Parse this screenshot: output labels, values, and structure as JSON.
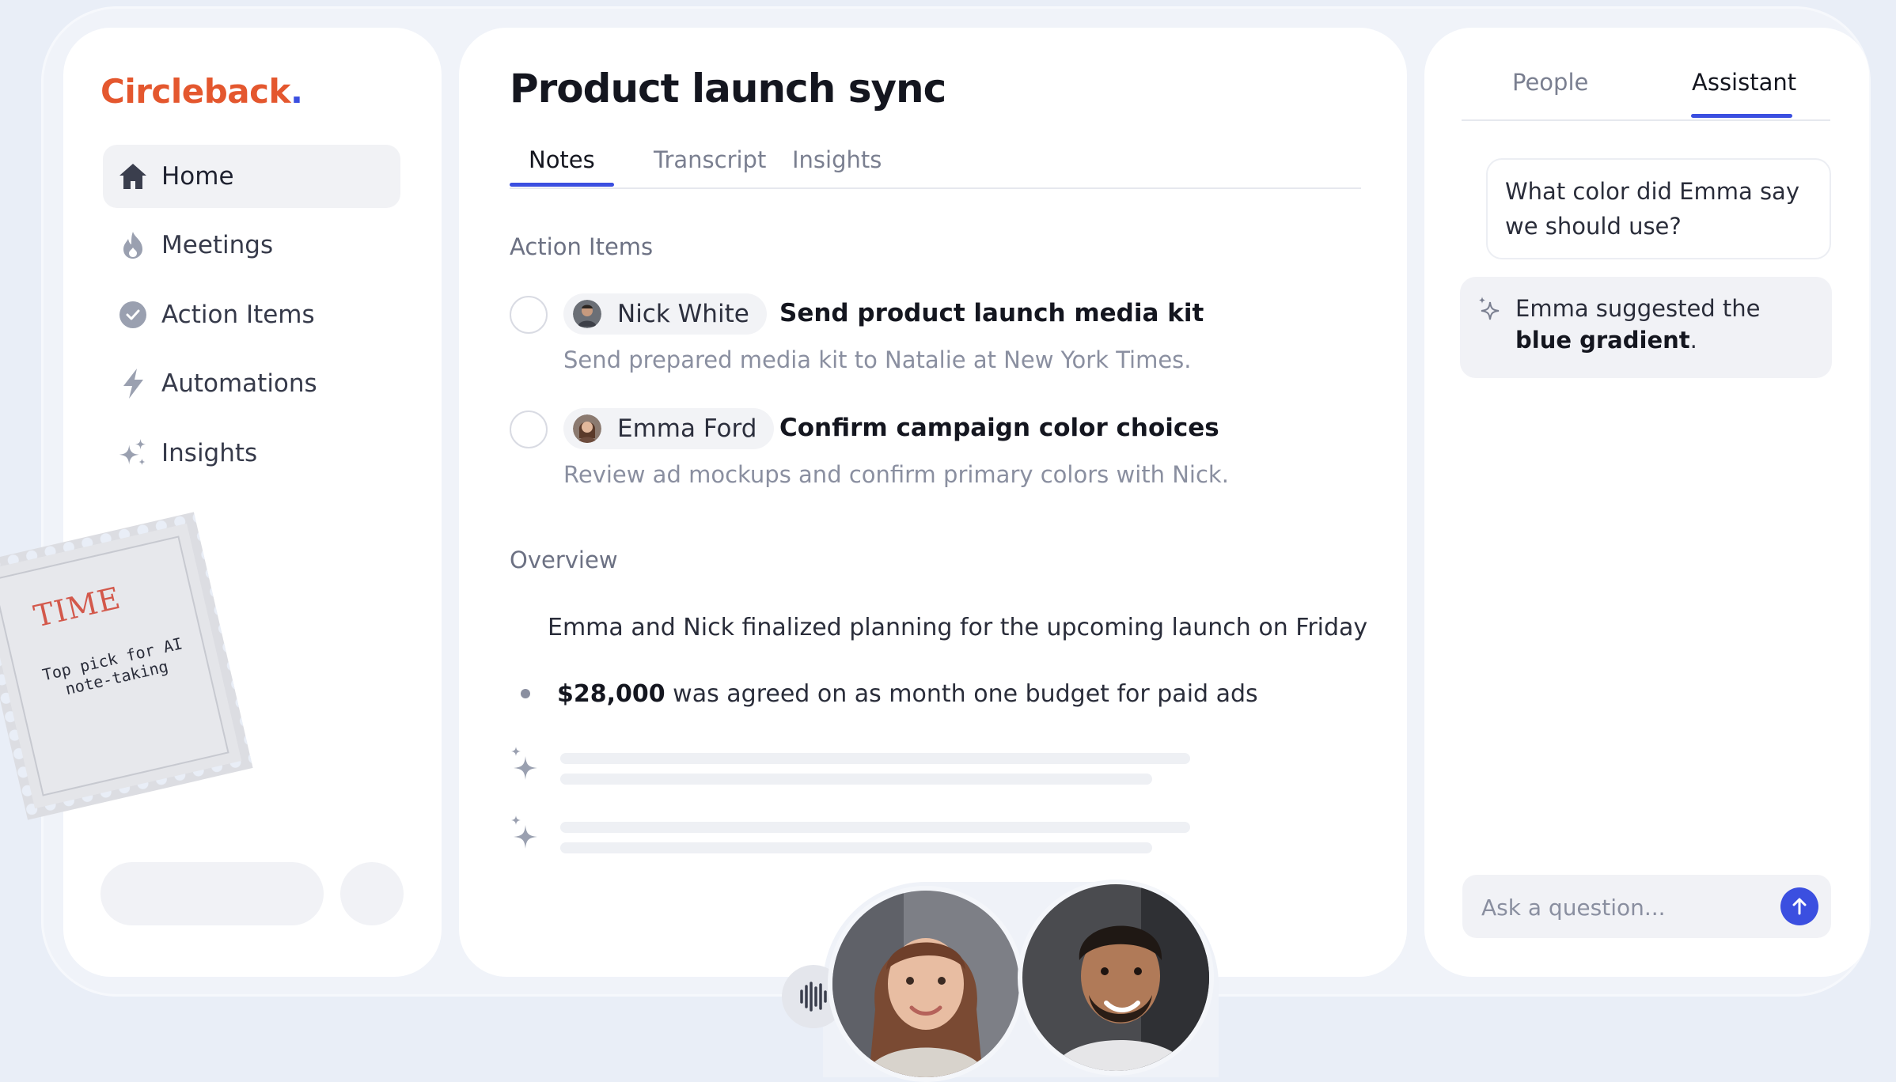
{
  "brand": {
    "name": "Circleback",
    "dot": "."
  },
  "sidebar": {
    "items": [
      {
        "label": "Home",
        "icon": "home-icon",
        "active": true
      },
      {
        "label": "Meetings",
        "icon": "flame-icon"
      },
      {
        "label": "Action Items",
        "icon": "check-circle-icon"
      },
      {
        "label": "Automations",
        "icon": "lightning-icon"
      },
      {
        "label": "Insights",
        "icon": "sparkles-icon"
      }
    ]
  },
  "main": {
    "title": "Product launch sync",
    "tabs": [
      {
        "label": "Notes",
        "active": true
      },
      {
        "label": "Transcript"
      },
      {
        "label": "Insights"
      }
    ],
    "action_items_title": "Action Items",
    "action_items": [
      {
        "assignee": "Nick White",
        "title": "Send product launch media kit",
        "description": "Send prepared media kit to Natalie at New York Times.",
        "done": false
      },
      {
        "assignee": "Emma Ford",
        "title": "Confirm campaign color choices",
        "description": "Review ad mockups and confirm primary colors with Nick.",
        "done": false
      }
    ],
    "overview_title": "Overview",
    "overview": [
      {
        "bold": "",
        "text": "Emma and Nick finalized  planning for the upcoming launch on Friday"
      },
      {
        "bold": "$28,000",
        "text": " was agreed on as month one budget for paid ads"
      }
    ]
  },
  "assistant": {
    "tabs": [
      {
        "label": "People"
      },
      {
        "label": "Assistant",
        "active": true
      }
    ],
    "user_message": "What color did Emma say we should use?",
    "reply_prefix": "Emma suggested the ",
    "reply_bold": "blue gradient",
    "reply_suffix": ".",
    "input_placeholder": "Ask a question..."
  },
  "stamp": {
    "brand": "TIME",
    "line1": "Top pick for AI",
    "line2": "note-taking"
  },
  "colors": {
    "brand": "#e4572e",
    "accent": "#3b4fe0",
    "background": "#e9eef7"
  }
}
